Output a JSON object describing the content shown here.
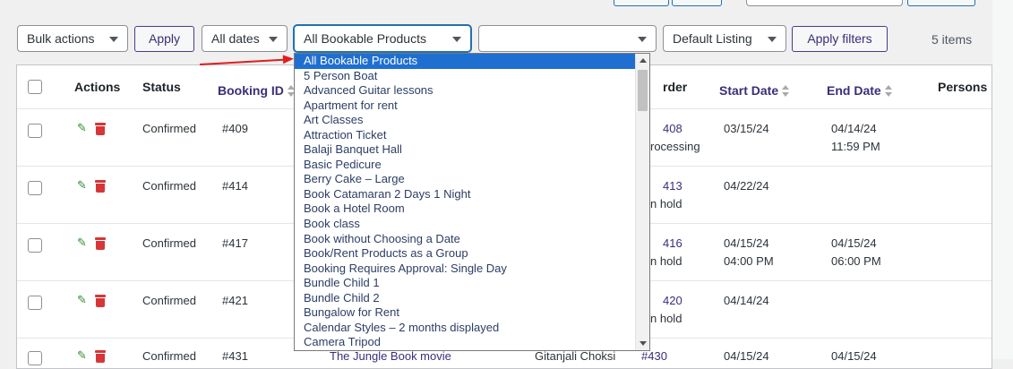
{
  "filters": {
    "bulk_actions": "Bulk actions",
    "apply": "Apply",
    "all_dates": "All dates",
    "bookable_product": "All Bookable Products",
    "empty_select": "",
    "listing": "Default Listing",
    "apply_filters": "Apply filters",
    "items_count": "5 items"
  },
  "columns": {
    "actions": "Actions",
    "status": "Status",
    "booking_id": "Booking ID",
    "order": "rder",
    "start_date": "Start Date",
    "end_date": "End Date",
    "persons": "Persons"
  },
  "rows": [
    {
      "status": "Confirmed",
      "id": "#409",
      "order": "408",
      "order_status": "rocessing",
      "start": "03/15/24",
      "start_time": "",
      "end": "04/14/24",
      "end_time": "11:59 PM"
    },
    {
      "status": "Confirmed",
      "id": "#414",
      "order": "413",
      "order_status": "n hold",
      "start": "04/22/24",
      "start_time": "",
      "end": "",
      "end_time": ""
    },
    {
      "status": "Confirmed",
      "id": "#417",
      "order": "416",
      "order_status": "n hold",
      "start": "04/15/24",
      "start_time": "04:00 PM",
      "end": "04/15/24",
      "end_time": "06:00 PM"
    },
    {
      "status": "Confirmed",
      "id": "#421",
      "order": "420",
      "order_status": "n hold",
      "start": "04/14/24",
      "start_time": "",
      "end": "",
      "end_time": ""
    },
    {
      "status": "Confirmed",
      "id": "#431",
      "product": "The Jungle Book movie",
      "customer": "Gitanjali Choksi",
      "order": "#430",
      "start": "04/15/24",
      "end": "04/15/24"
    }
  ],
  "dropdown_options": [
    "All Bookable Products",
    "5 Person Boat",
    "Advanced Guitar lessons",
    "Apartment for rent",
    "Art Classes",
    "Attraction Ticket",
    "Balaji Banquet Hall",
    "Basic Pedicure",
    "Berry Cake – Large",
    "Book Catamaran 2 Days 1 Night",
    "Book a Hotel Room",
    "Book class",
    "Book without Choosing a Date",
    "Book/Rent Products as a Group",
    "Booking Requires Approval: Single Day",
    "Bundle Child 1",
    "Bundle Child 2",
    "Bungalow for Rent",
    "Calendar Styles – 2 months displayed",
    "Camera Tripod"
  ],
  "colors": {
    "accent": "#2271b1",
    "purple": "#3c2d7a",
    "selected_option": "#1f6fd1",
    "annotation_arrow": "#e11d1d",
    "delete_icon": "#d63638",
    "edit_icon": "#2e8b2e"
  },
  "icons": {
    "edit": "pencil-icon",
    "delete": "trash-icon",
    "dropdown": "chevron-down-icon",
    "sort": "sort-arrows-icon"
  }
}
